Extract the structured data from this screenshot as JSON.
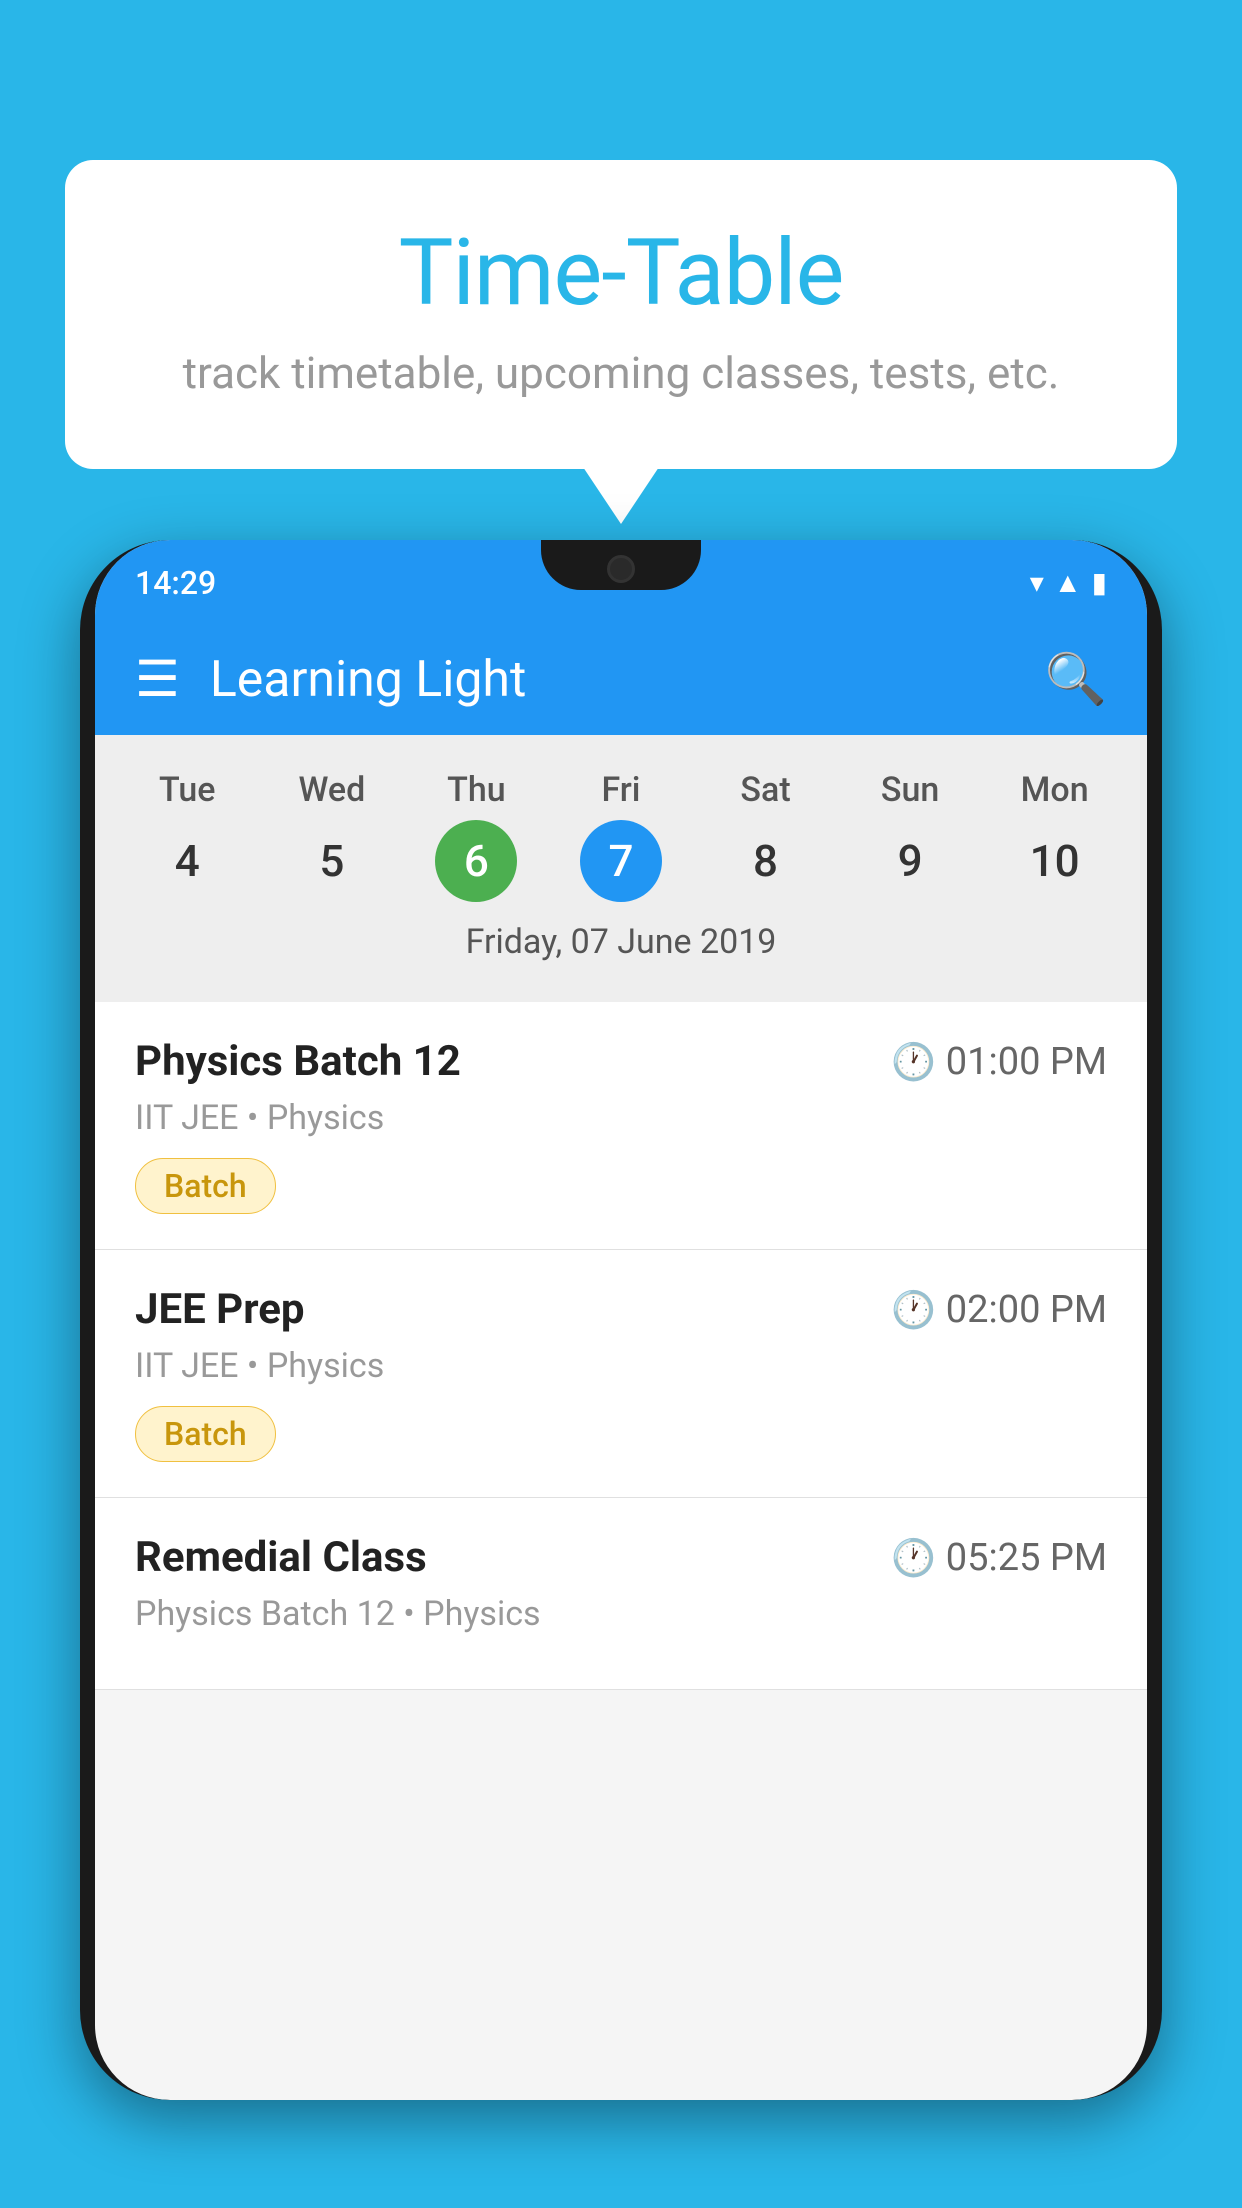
{
  "background_color": "#29B6E8",
  "bubble": {
    "title": "Time-Table",
    "subtitle": "track timetable, upcoming classes, tests, etc."
  },
  "phone": {
    "status_bar": {
      "time": "14:29"
    },
    "app_bar": {
      "title": "Learning Light"
    },
    "calendar": {
      "days": [
        {
          "name": "Tue",
          "number": "4",
          "state": "normal"
        },
        {
          "name": "Wed",
          "number": "5",
          "state": "normal"
        },
        {
          "name": "Thu",
          "number": "6",
          "state": "today"
        },
        {
          "name": "Fri",
          "number": "7",
          "state": "selected"
        },
        {
          "name": "Sat",
          "number": "8",
          "state": "normal"
        },
        {
          "name": "Sun",
          "number": "9",
          "state": "normal"
        },
        {
          "name": "Mon",
          "number": "10",
          "state": "normal"
        }
      ],
      "selected_date": "Friday, 07 June 2019"
    },
    "schedule": [
      {
        "title": "Physics Batch 12",
        "time": "01:00 PM",
        "meta": "IIT JEE • Physics",
        "badge": "Batch"
      },
      {
        "title": "JEE Prep",
        "time": "02:00 PM",
        "meta": "IIT JEE • Physics",
        "badge": "Batch"
      },
      {
        "title": "Remedial Class",
        "time": "05:25 PM",
        "meta": "Physics Batch 12 • Physics"
      }
    ]
  }
}
